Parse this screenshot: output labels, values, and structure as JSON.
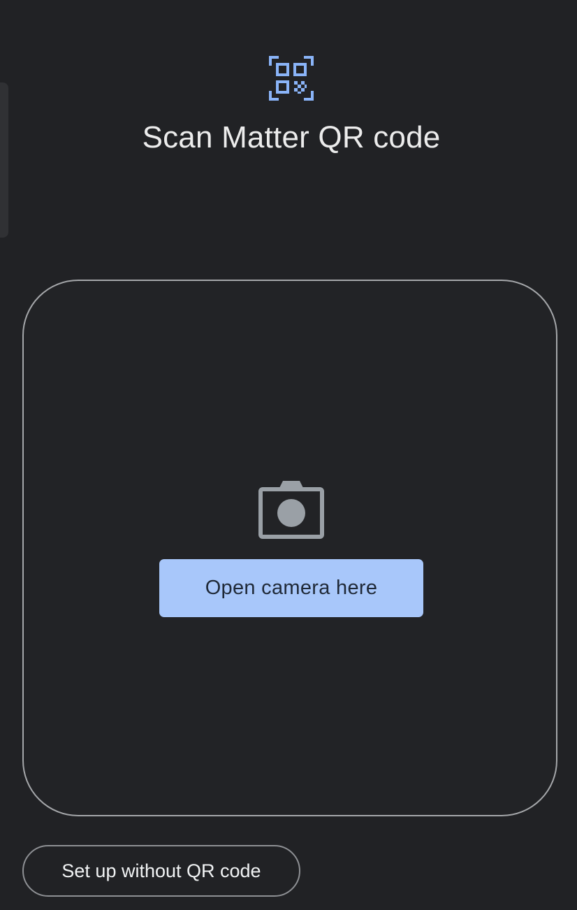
{
  "header": {
    "icon": "qr-code-scanner-icon",
    "title": "Scan Matter QR code"
  },
  "viewfinder": {
    "icon": "camera-icon",
    "open_camera_label": "Open camera here"
  },
  "footer": {
    "setup_without_qr_label": "Set up without QR code"
  },
  "colors": {
    "background": "#212225",
    "accent": "#a8c7fa",
    "icon_blue": "#8ab4f8",
    "outline": "#a5a7aa",
    "camera_icon": "#9aa0a6"
  }
}
